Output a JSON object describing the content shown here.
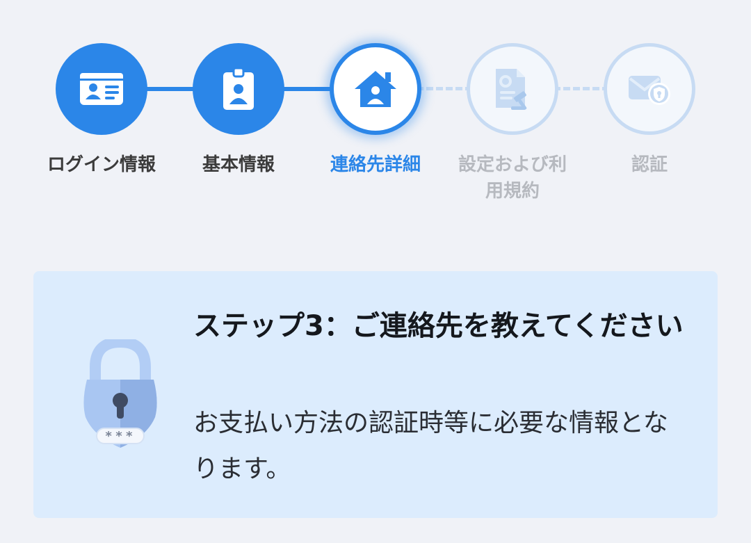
{
  "stepper": {
    "steps": [
      {
        "label": "ログイン情報",
        "state": "done",
        "icon": "id-card-icon"
      },
      {
        "label": "基本情報",
        "state": "done",
        "icon": "id-badge-icon"
      },
      {
        "label": "連絡先詳細",
        "state": "active",
        "icon": "home-user-icon"
      },
      {
        "label": "設定および利用規約",
        "state": "todo",
        "icon": "settings-document-icon"
      },
      {
        "label": "認証",
        "state": "todo",
        "icon": "mail-shield-icon"
      }
    ]
  },
  "card": {
    "title": "ステップ3：ご連絡先を教えてください",
    "description": "お支払い方法の認証時等に必要な情報となります。",
    "illustration": "padlock-password-icon",
    "password_mask": "***"
  },
  "colors": {
    "accent": "#2b86e8",
    "inactive": "#c7dbf3",
    "background": "#f0f2f7",
    "card_background": "#dcecfd"
  }
}
